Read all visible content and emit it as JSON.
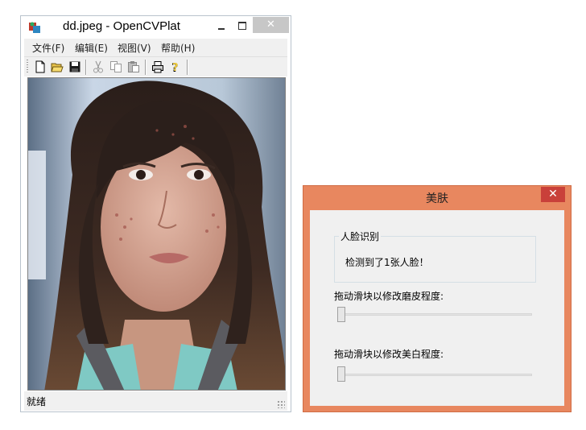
{
  "main_window": {
    "title": "dd.jpeg - OpenCVPlat",
    "close_glyph": "✕",
    "menu": [
      "文件(F)",
      "编辑(E)",
      "视图(V)",
      "帮助(H)"
    ],
    "toolbar_icons": [
      "new-file-icon",
      "open-folder-icon",
      "save-icon",
      "cut-icon",
      "copy-icon",
      "paste-icon",
      "print-icon",
      "help-icon"
    ],
    "status": "就绪"
  },
  "dialog": {
    "title": "美肤",
    "close_glyph": "✕",
    "face_group_title": "人脸识别",
    "face_message": "检测到了1张人脸！",
    "smooth_label": "拖动滑块以修改磨皮程度:",
    "smooth_value": 0,
    "whiten_label": "拖动滑块以修改美白程度:",
    "whiten_value": 0
  },
  "colors": {
    "dialog_frame": "#e8875f",
    "dialog_close": "#c9403a",
    "main_close": "#c7c7c7"
  }
}
